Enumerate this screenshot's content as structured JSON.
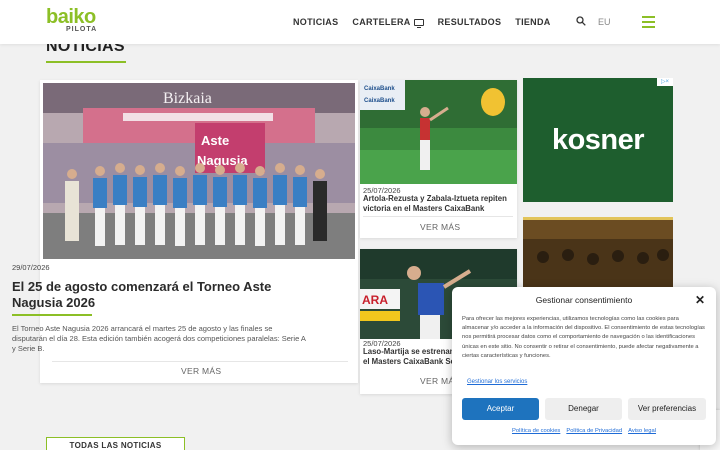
{
  "brand": {
    "name": "baiko",
    "subtitle": "PILOTA",
    "accent": "#8cbf26"
  },
  "nav": {
    "items": [
      "NOTICIAS",
      "CARTELERA",
      "RESULTADOS",
      "TIENDA"
    ],
    "lang": "EU"
  },
  "section": {
    "title": "NOTICIAS"
  },
  "featured": {
    "image_text": {
      "banner": "Bizkaia",
      "sign_line1": "Aste",
      "sign_line2": "Nagusia"
    },
    "date": "29/07/2026",
    "title": "El 25 de agosto comenzará el Torneo Aste Nagusia 2026",
    "excerpt": "El Torneo Aste Nagusia 2026 arrancará el martes 25 de agosto y las finales se disputarán el día 28. Esta edición también acogerá dos competiciones paralelas: Serie A y Serie B.",
    "more": "VER MÁS"
  },
  "cards": [
    {
      "date": "25/07/2026",
      "title": "Artola-Rezusta y Zabala-Iztueta repiten victoria en el Masters CaixaBank",
      "more": "VER MÁS",
      "image_text": "CaixaBank"
    },
    {
      "date": "25/07/2026",
      "title": "Laso-Martija se estrenan con victoria en el Masters CaixaBank Se",
      "more": "VER MÁS",
      "image_text": "ARA"
    }
  ],
  "ads": {
    "kosner": "kosner"
  },
  "all_news": "TODAS LAS NOTICIAS",
  "consent": {
    "title": "Gestionar consentimiento",
    "body": "Para ofrecer las mejores experiencias, utilizamos tecnologías como las cookies para almacenar y/o acceder a la información del dispositivo. El consentimiento de estas tecnologías nos permitirá procesar datos como el comportamiento de navegación o las identificaciones únicas en este sitio. No consentir o retirar el consentimiento, puede afectar negativamente a ciertas características y funciones.",
    "manage_link": "Gestionar los servicios",
    "accept": "Aceptar",
    "deny": "Denegar",
    "preferences": "Ver preferencias",
    "footer_links": [
      "Política de cookies",
      "Política de Privacidad",
      "Aviso legal"
    ]
  }
}
